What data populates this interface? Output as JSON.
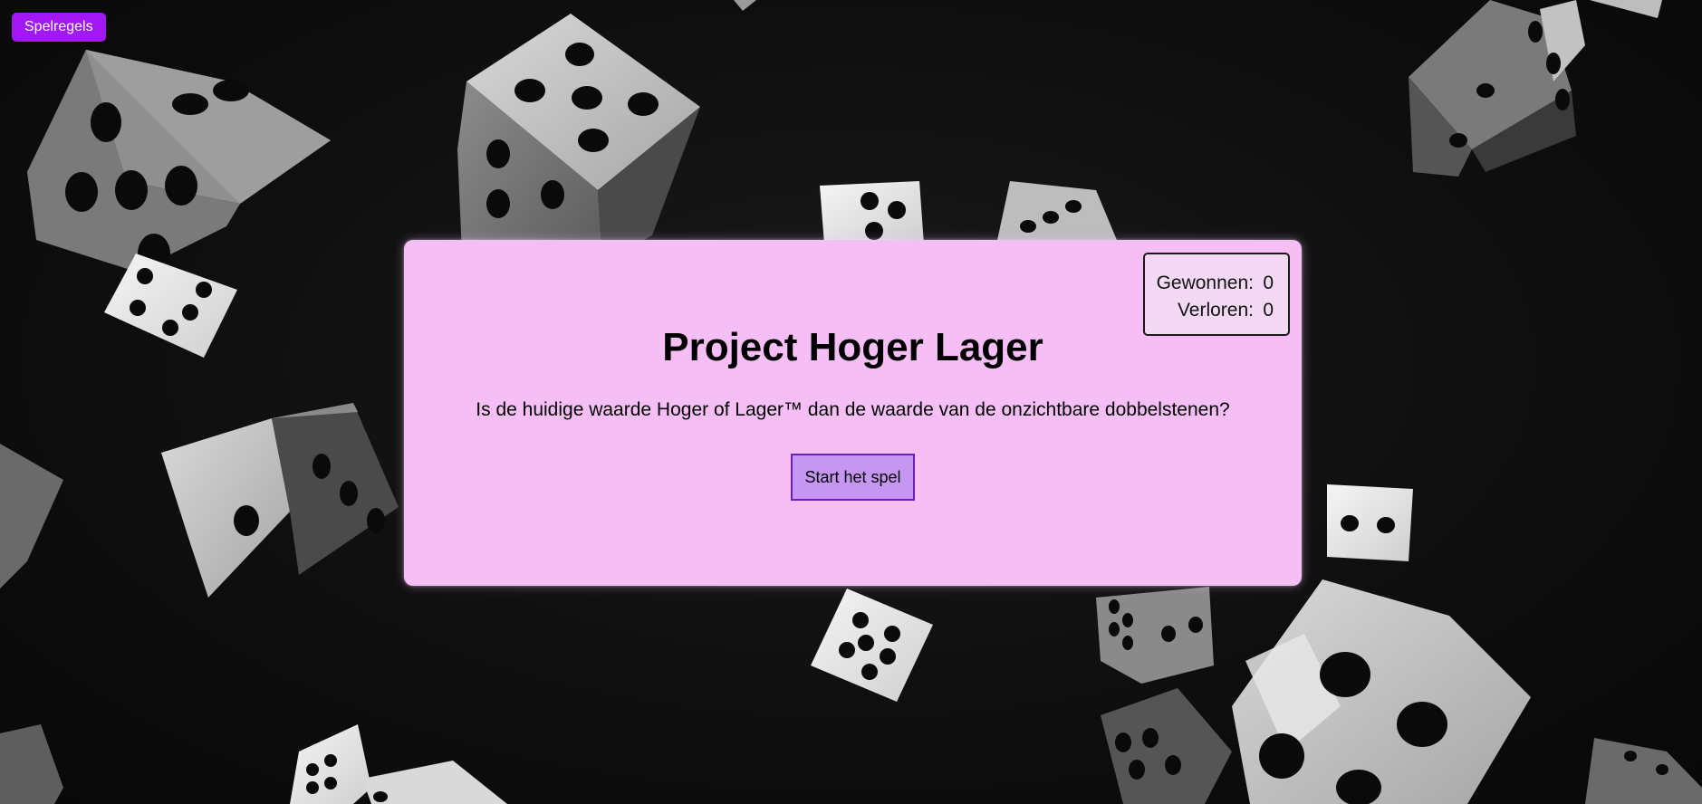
{
  "toolbar": {
    "rules_label": "Spelregels"
  },
  "game": {
    "title": "Project Hoger Lager",
    "question": "Is de huidige waarde Hoger of Lager™ dan de waarde van de onzichtbare dobbelstenen?",
    "start_label": "Start het spel"
  },
  "score": {
    "won_label": "Gewonnen:",
    "won_value": "0",
    "lost_label": "Verloren:",
    "lost_value": "0"
  },
  "colors": {
    "rules_button": "#a118f5",
    "panel_background": "#f5bef5",
    "start_button": "#c597f2",
    "start_button_border": "#6a1fc0"
  }
}
